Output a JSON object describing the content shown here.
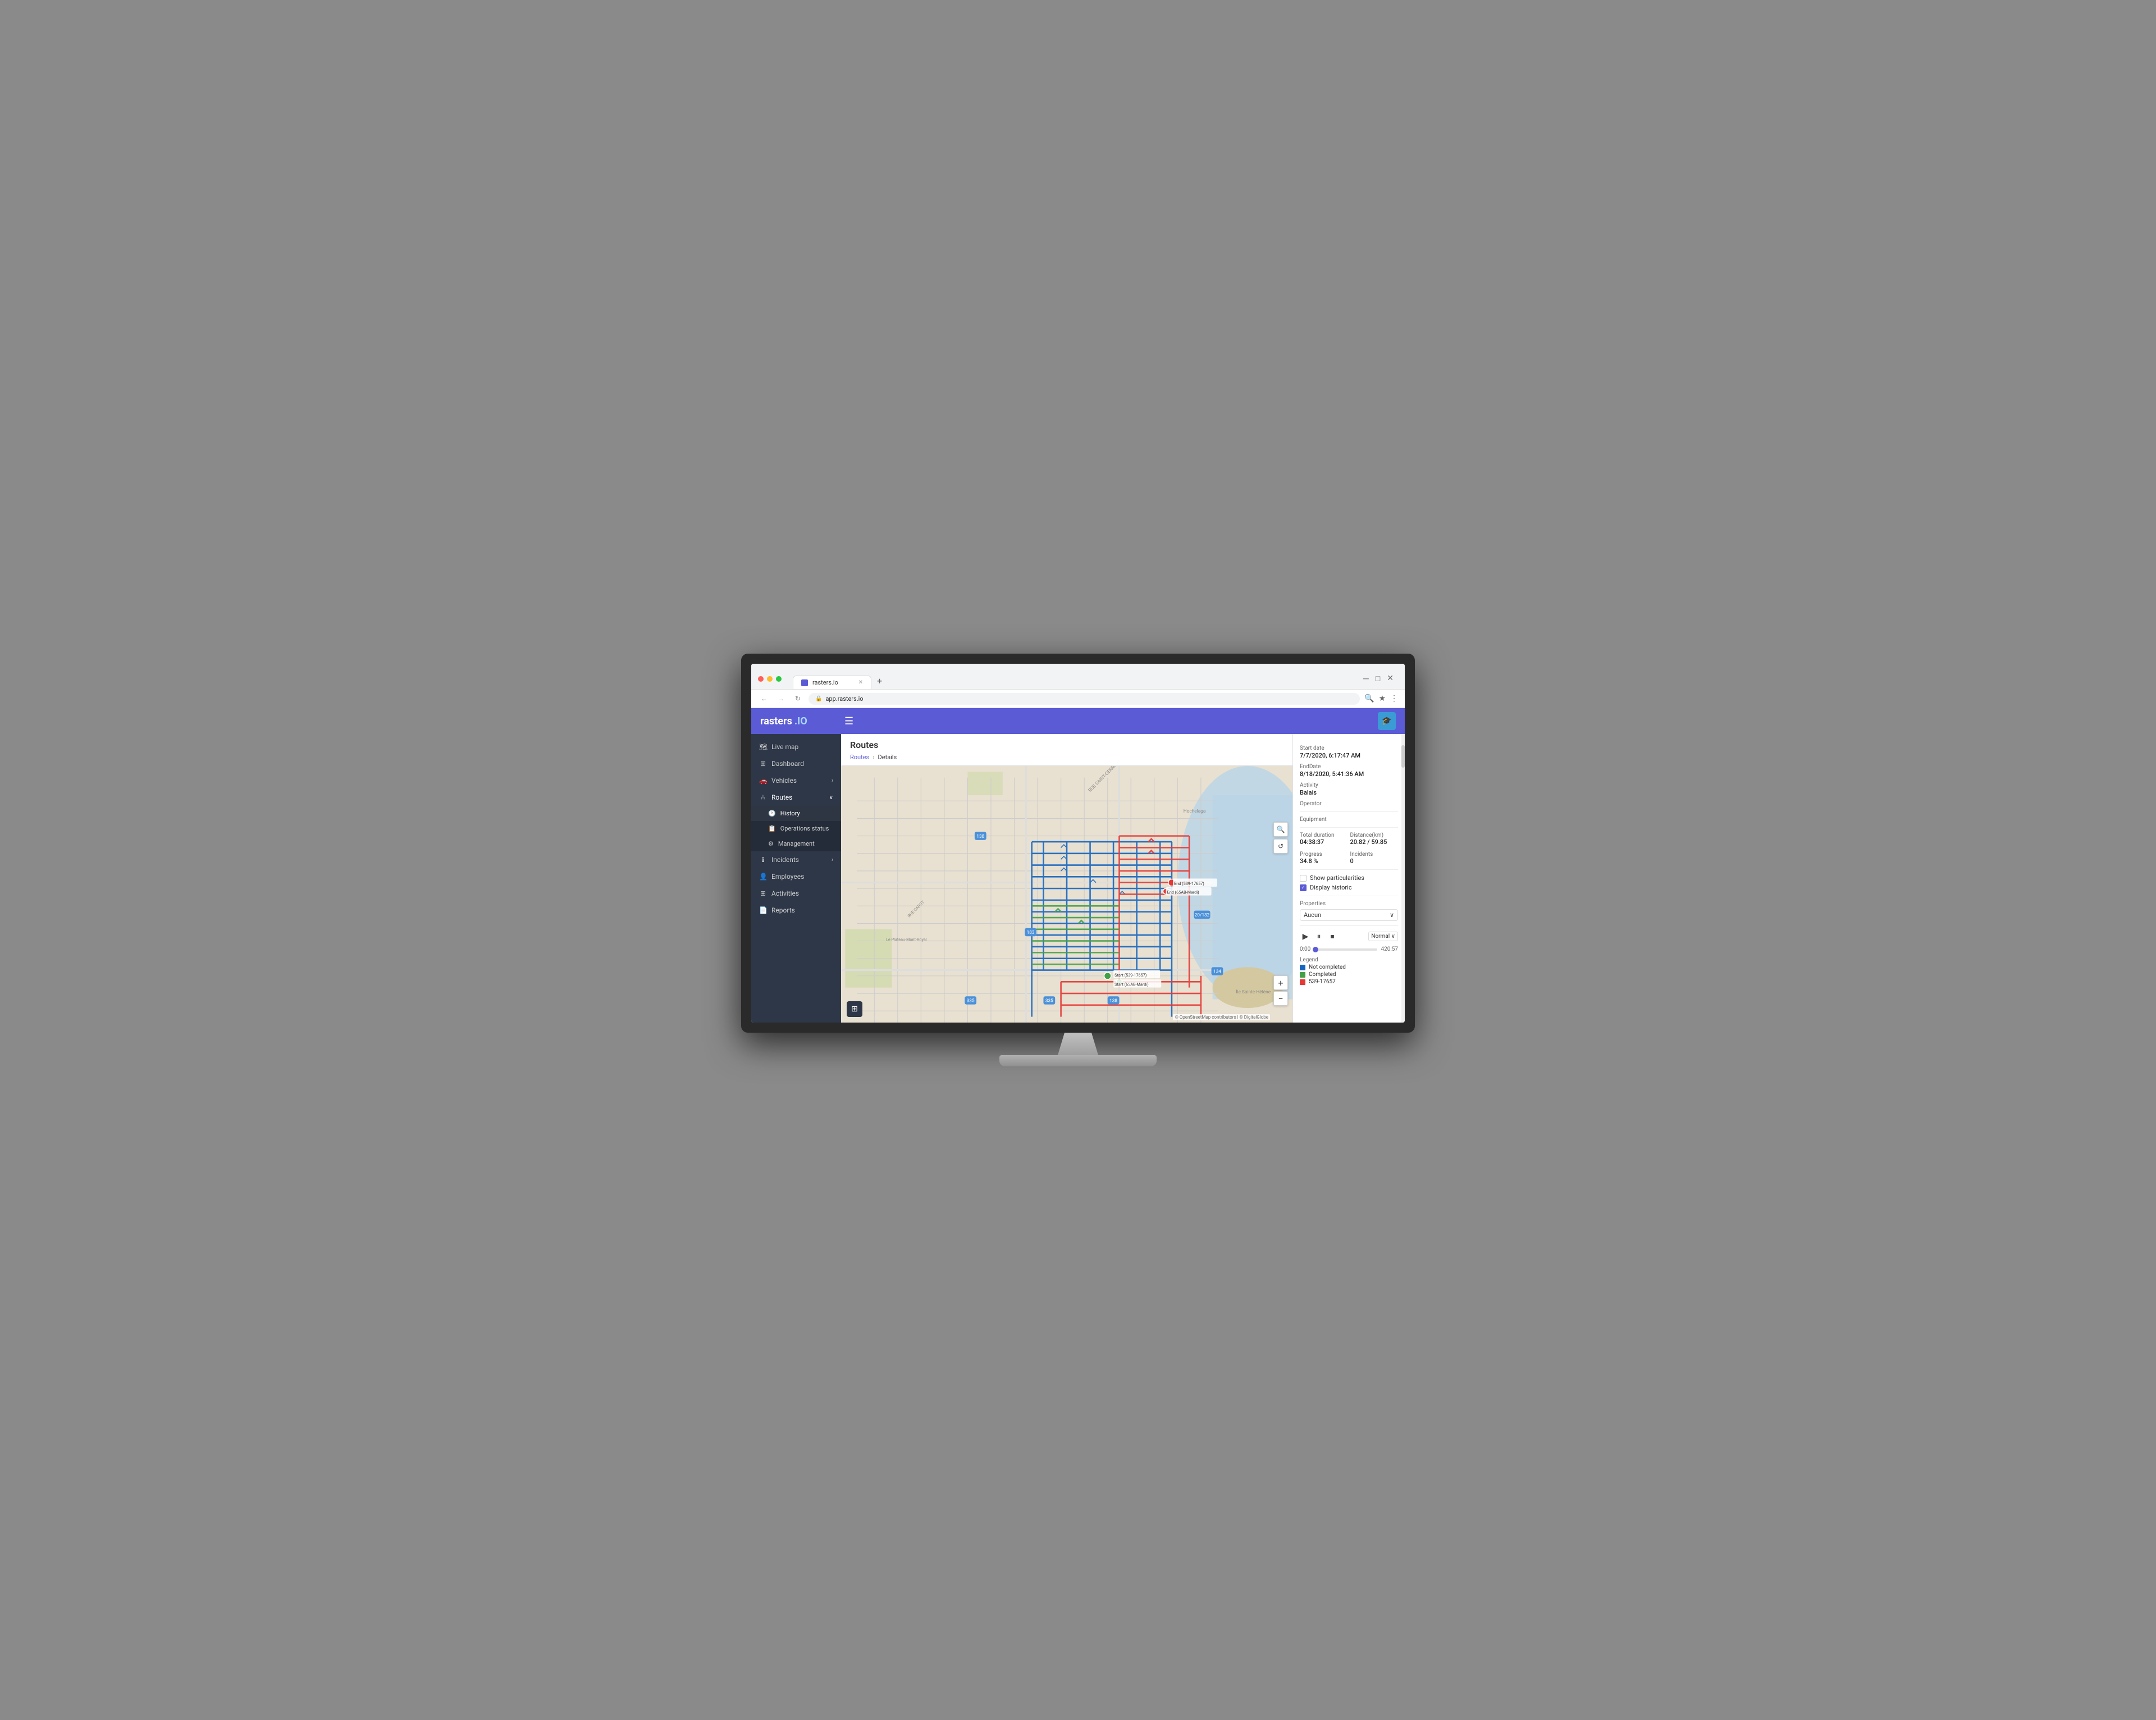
{
  "browser": {
    "tab_title": "rasters.io",
    "tab_new": "+",
    "address": "app.rasters.io",
    "nav_back": "←",
    "nav_forward": "→",
    "nav_refresh": "↻",
    "menu_dots": "⋮"
  },
  "header": {
    "logo_rasters": "rasters",
    "logo_io": ".IO",
    "hamburger": "☰",
    "avatar_icon": "🎓"
  },
  "sidebar": {
    "items": [
      {
        "id": "live-map",
        "label": "Live map",
        "icon": "🗺"
      },
      {
        "id": "dashboard",
        "label": "Dashboard",
        "icon": "⊞"
      },
      {
        "id": "vehicles",
        "label": "Vehicles",
        "icon": "🚗",
        "has_chevron": true
      },
      {
        "id": "routes",
        "label": "Routes",
        "icon": "⑃",
        "has_chevron": true,
        "active": true
      }
    ],
    "sub_items": [
      {
        "id": "history",
        "label": "History",
        "icon": "🕐",
        "active": true
      },
      {
        "id": "operations-status",
        "label": "Operations status",
        "icon": "📋"
      },
      {
        "id": "management",
        "label": "Management",
        "icon": "⚙"
      }
    ],
    "bottom_items": [
      {
        "id": "incidents",
        "label": "Incidents",
        "icon": "ℹ",
        "has_chevron": true
      },
      {
        "id": "employees",
        "label": "Employees",
        "icon": "👤"
      },
      {
        "id": "activities",
        "label": "Activities",
        "icon": "⊞"
      },
      {
        "id": "reports",
        "label": "Reports",
        "icon": "📄"
      }
    ]
  },
  "breadcrumb": {
    "items": [
      "Routes",
      "Details"
    ],
    "separator": "›"
  },
  "page": {
    "title": "Routes"
  },
  "right_panel": {
    "start_date_label": "Start date",
    "start_date_value": "7/7/2020, 6:17:47 AM",
    "end_date_label": "EndDate",
    "end_date_value": "8/18/2020, 5:41:36 AM",
    "activity_label": "Activity",
    "activity_value": "Balais",
    "operator_label": "Operator",
    "operator_value": "",
    "equipment_label": "Equipment",
    "equipment_value": "",
    "total_duration_label": "Total duration",
    "distance_label": "Distance(km)",
    "total_duration_value": "04:38:37",
    "distance_value": "20.82 / 59.85",
    "progress_label": "Progress",
    "incidents_label": "Incidents",
    "progress_value": "34.8 %",
    "incidents_value": "0",
    "show_particularities_label": "Show particularities",
    "display_historic_label": "Display historic",
    "display_historic_checked": true,
    "show_particularities_checked": false,
    "properties_label": "Properties",
    "properties_select": "Aucun",
    "playback_speed": "Normal",
    "timeline_start": "0:00",
    "timeline_end": "420:57",
    "legend_label": "Legend",
    "legend_items": [
      {
        "label": "Not completed",
        "color": "#1565c0"
      },
      {
        "label": "Completed",
        "color": "#43a047"
      },
      {
        "label": "539-17657",
        "color": "#e53935"
      }
    ]
  },
  "map": {
    "start_label_1": "Start (539-17657)",
    "start_label_2": "Start (65AB-Mardi)",
    "end_label_1": "End (539-17657)",
    "end_label_2": "End (65AB-Mardi)",
    "attribution": "© OpenStreetMap contributors | © DigitalGlobe"
  }
}
